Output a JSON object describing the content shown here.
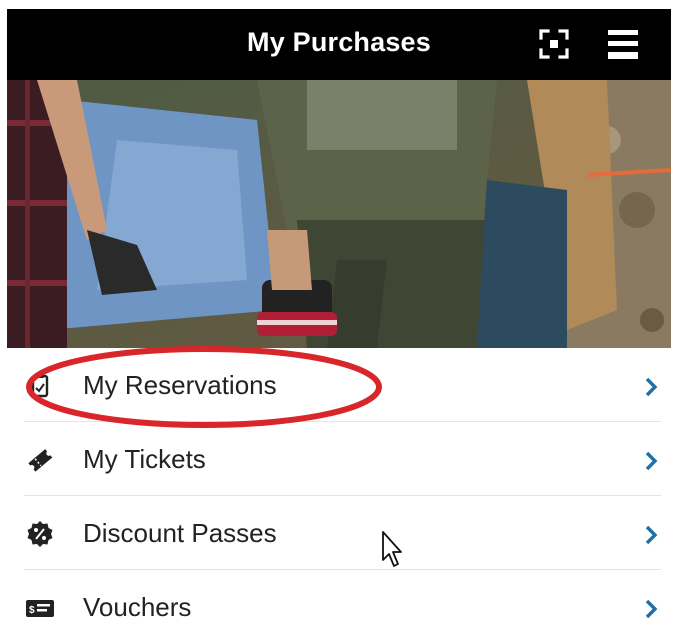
{
  "header": {
    "title": "My Purchases",
    "scan_icon": "qr-scan-icon",
    "menu_icon": "hamburger-menu-icon"
  },
  "hero": {
    "description_icon": "camping-photo"
  },
  "menu": {
    "items": [
      {
        "label": "My Reservations",
        "icon": "clipboard-icon"
      },
      {
        "label": "My Tickets",
        "icon": "ticket-icon"
      },
      {
        "label": "Discount Passes",
        "icon": "discount-badge-icon"
      },
      {
        "label": "Vouchers",
        "icon": "voucher-icon"
      }
    ],
    "chevron_icon": "chevron-right-icon"
  },
  "colors": {
    "header_bg": "#000000",
    "header_text": "#ffffff",
    "chevron": "#1f6fa8",
    "annotation": "#d9262a",
    "label_text": "#222222"
  }
}
